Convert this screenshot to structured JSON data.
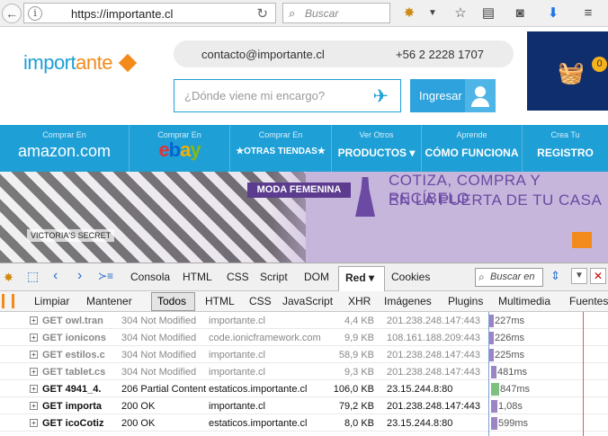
{
  "browser": {
    "url": "https://importante.cl",
    "search_placeholder": "Buscar"
  },
  "header": {
    "logo_main": "import",
    "logo_accent": "ante",
    "email": "contacto@importante.cl",
    "phone": "+56 2 2228 1707",
    "track_placeholder": "¿Dónde viene mi encargo?",
    "login_label": "Ingresar",
    "cart_count": "0"
  },
  "menu": {
    "items": [
      {
        "top": "Comprar En",
        "main": "amazon.com"
      },
      {
        "top": "Comprar En",
        "main": "ebay"
      },
      {
        "top": "Comprar En",
        "main": "★OTRAS TIENDAS★"
      },
      {
        "top": "Ver Otros",
        "main": "PRODUCTOS ▾"
      },
      {
        "top": "Aprende",
        "main": "CÓMO FUNCIONA"
      },
      {
        "top": "Crea Tu",
        "main": "REGISTRO"
      }
    ]
  },
  "banner": {
    "tag": "MODA FEMENINA",
    "line1": "COTIZA, COMPRA Y RECÍBELO",
    "line2": "EN LA PUERTA DE TU CASA",
    "brand": "VICTORIA'S SECRET"
  },
  "devtools": {
    "tabs": [
      "Consola",
      "HTML",
      "CSS",
      "Script",
      "DOM",
      "Red ▾",
      "Cookies"
    ],
    "search_placeholder": "Buscar en",
    "filters": [
      "Limpiar",
      "Mantener",
      "Todos",
      "HTML",
      "CSS",
      "JavaScript",
      "XHR",
      "Imágenes",
      "Plugins",
      "Multimedia",
      "Fuentes"
    ],
    "rows": [
      {
        "method": "GET owl.tran",
        "status": "304 Not Modified",
        "domain": "importante.cl",
        "size": "4,4 KB",
        "ip": "201.238.248.147:443",
        "time": "227ms",
        "start": 0.02,
        "dur": 0.05,
        "cached": true
      },
      {
        "method": "GET ionicons",
        "status": "304 Not Modified",
        "domain": "code.ionicframework.com",
        "size": "9,9 KB",
        "ip": "108.161.188.209:443",
        "time": "226ms",
        "start": 0.02,
        "dur": 0.05,
        "cached": true
      },
      {
        "method": "GET estilos.c",
        "status": "304 Not Modified",
        "domain": "importante.cl",
        "size": "58,9 KB",
        "ip": "201.238.248.147:443",
        "time": "225ms",
        "start": 0.02,
        "dur": 0.05,
        "cached": true
      },
      {
        "method": "GET tablet.cs",
        "status": "304 Not Modified",
        "domain": "importante.cl",
        "size": "9,3 KB",
        "ip": "201.238.248.147:443",
        "time": "481ms",
        "start": 0.04,
        "dur": 0.05,
        "cached": true
      },
      {
        "method": "GET 4941_4.",
        "status": "206 Partial Content",
        "domain": "estaticos.importante.cl",
        "size": "106,0 KB",
        "ip": "23.15.244.8:80",
        "time": "847ms",
        "start": 0.04,
        "dur": 0.08,
        "cached": false,
        "green": true
      },
      {
        "method": "GET importa",
        "status": "200 OK",
        "domain": "importante.cl",
        "size": "79,2 KB",
        "ip": "201.238.248.147:443",
        "time": "1,08s",
        "start": 0.04,
        "dur": 0.06,
        "cached": false
      },
      {
        "method": "GET icoCotiz",
        "status": "200 OK",
        "domain": "estaticos.importante.cl",
        "size": "8,0 KB",
        "ip": "23.15.244.8:80",
        "time": "599ms",
        "start": 0.04,
        "dur": 0.06,
        "cached": false
      }
    ]
  }
}
